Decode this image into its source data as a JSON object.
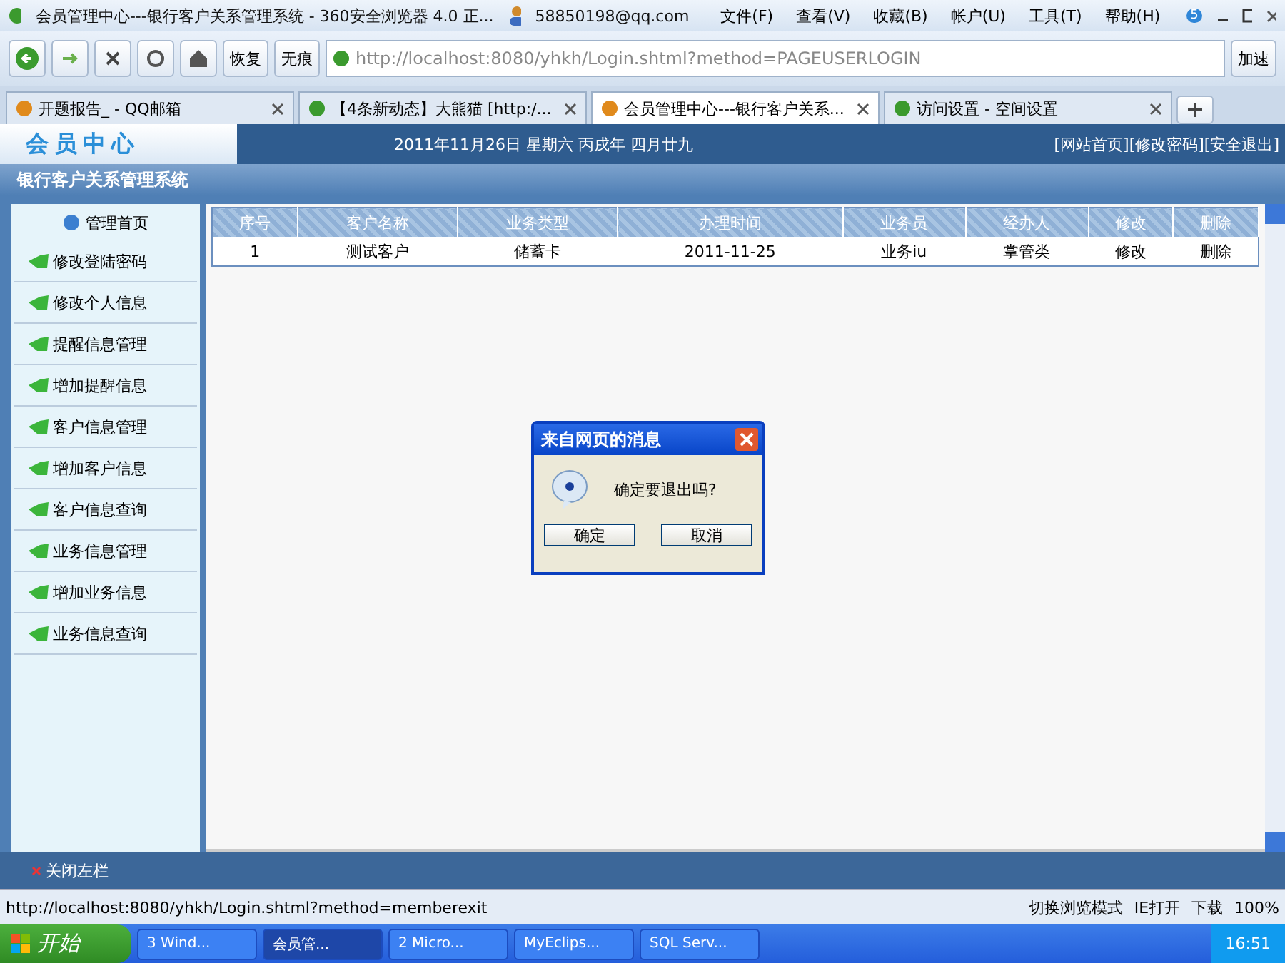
{
  "window": {
    "title": "会员管理中心---银行客户关系管理系统 - 360安全浏览器 4.0 正...",
    "account": "58850198@qq.com",
    "menu": [
      "文件(F)",
      "查看(V)",
      "收藏(B)",
      "帐户(U)",
      "工具(T)",
      "帮助(H)"
    ],
    "badge": "5"
  },
  "toolbar": {
    "restore": "恢复",
    "incognito": "无痕",
    "address": "http://localhost:8080/yhkh/Login.shtml?method=PAGEUSERLOGIN",
    "speed": "加速"
  },
  "tabs": [
    {
      "label": "开题报告_ - QQ邮箱",
      "selected": false
    },
    {
      "label": "【4条新动态】大熊猫 [http:/...",
      "selected": false
    },
    {
      "label": "会员管理中心---银行客户关系...",
      "selected": true
    },
    {
      "label": "访问设置 - 空间设置",
      "selected": false
    }
  ],
  "page": {
    "logo": "会员中心",
    "date": "2011年11月26日 星期六 丙戌年 四月廿九",
    "links": [
      "[网站首页]",
      "[修改密码]",
      "[安全退出]"
    ],
    "system": "银行客户关系管理系统",
    "home": "管理首页",
    "sidebar": [
      "修改登陆密码",
      "修改个人信息",
      "提醒信息管理",
      "增加提醒信息",
      "客户信息管理",
      "增加客户信息",
      "客户信息查询",
      "业务信息管理",
      "增加业务信息",
      "业务信息查询"
    ],
    "table": {
      "columns": [
        "序号",
        "客户名称",
        "业务类型",
        "办理时间",
        "业务员",
        "经办人",
        "修改",
        "删除"
      ],
      "rows": [
        [
          "1",
          "测试客户",
          "储蓄卡",
          "2011-11-25",
          "业务iu",
          "掌管类",
          "修改",
          "删除"
        ]
      ]
    },
    "close_sidebar": "关闭左栏"
  },
  "dialog": {
    "title": "来自网页的消息",
    "message": "确定要退出吗?",
    "buttons": [
      "确定",
      "取消"
    ]
  },
  "status_bar": {
    "url": "http://localhost:8080/yhkh/Login.shtml?method=memberexit",
    "mode": "切换浏览模式",
    "ie": "IE打开",
    "download": "下载",
    "zoom": "100%"
  },
  "taskbar": {
    "start": "开始",
    "tasks": [
      {
        "label": "3 Wind...",
        "selected": false
      },
      {
        "label": "会员管...",
        "selected": true
      },
      {
        "label": "2 Micro...",
        "selected": false
      },
      {
        "label": "MyEclips...",
        "selected": false
      },
      {
        "label": "SQL Serv...",
        "selected": false
      }
    ],
    "clock": "16:51"
  }
}
